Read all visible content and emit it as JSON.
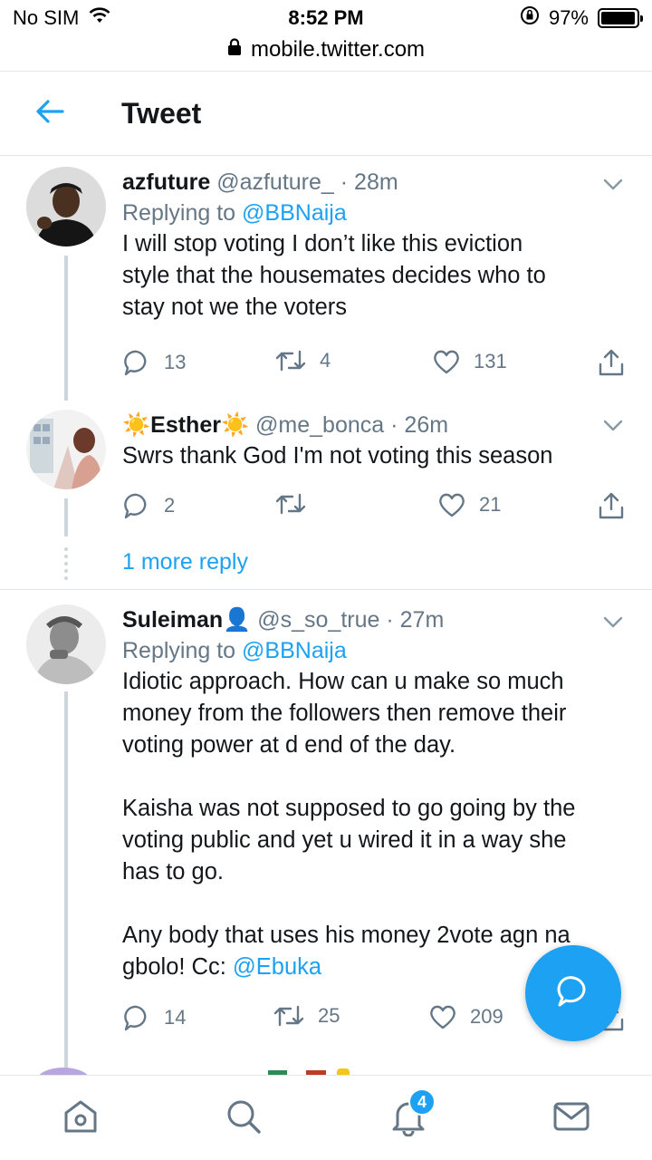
{
  "status_bar": {
    "carrier": "No SIM",
    "time": "8:52 PM",
    "battery": "97%",
    "battery_level": 0.97
  },
  "browser": {
    "url": "mobile.twitter.com"
  },
  "header": {
    "title": "Tweet"
  },
  "replies": [
    {
      "name": "azfuture",
      "handle": "@azfuture_",
      "separator": "·",
      "time": "28m",
      "replying_prefix": "Replying to",
      "replying_to": "@BBNaija",
      "text": [
        "I will stop voting I don’t like this eviction",
        "style that the housemates decides who to",
        "stay not we the voters"
      ],
      "reply_count": "13",
      "retweet_count": "4",
      "like_count": "131"
    },
    {
      "name": "Esther",
      "name_emoji": "☀️",
      "handle": "@me_bonca",
      "separator": "·",
      "time": "26m",
      "text": [
        "Swrs thank God I'm not voting this season"
      ],
      "reply_count": "2",
      "retweet_count": "",
      "like_count": "21"
    },
    {
      "name": "Suleiman",
      "name_emoji": "👤",
      "handle": "@s_so_true",
      "separator": "·",
      "time": "27m",
      "replying_prefix": "Replying to",
      "replying_to": "@BBNaija",
      "text": [
        "Idiotic approach. How can u make so much",
        "money from the followers then remove their",
        "voting power at d end of the day.",
        "",
        "Kaisha was not supposed to go going by the",
        "voting public and yet u wired it in a way she",
        "has to go.",
        "",
        "Any body that uses his money 2vote agn na"
      ],
      "text_last_prefix": "gbolo! Cc: ",
      "text_last_mention": "@Ebuka",
      "reply_count": "14",
      "retweet_count": "25",
      "like_count": "209"
    }
  ],
  "more_replies": "1 more reply",
  "notifications_badge": "4",
  "colors": {
    "accent": "#1da1f2",
    "secondary_text": "#657786",
    "divider": "#e1e8ed"
  },
  "icons": {
    "back": "arrow-left-icon",
    "compose": "chat-bubble-icon",
    "nav": [
      "home-icon",
      "search-icon",
      "bell-icon",
      "mail-icon"
    ]
  }
}
